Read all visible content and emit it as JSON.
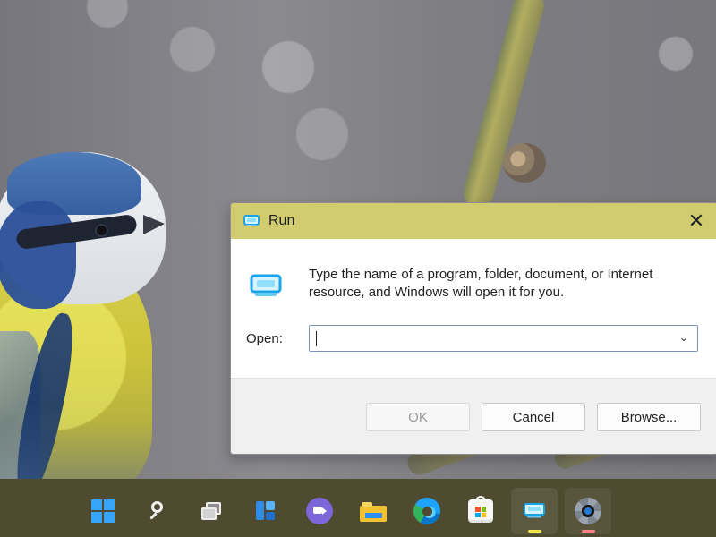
{
  "dialog": {
    "title": "Run",
    "description": "Type the name of a program, folder, document, or Internet resource, and Windows will open it for you.",
    "open_label": "Open:",
    "open_value": "",
    "dropdown_icon": "chevron-down-icon",
    "buttons": {
      "ok": "OK",
      "cancel": "Cancel",
      "browse": "Browse..."
    },
    "close_icon": "close-icon",
    "title_icon": "run-icon"
  },
  "taskbar": {
    "items": [
      {
        "name": "start",
        "icon": "windows-icon",
        "active": false
      },
      {
        "name": "search",
        "icon": "search-icon",
        "active": false
      },
      {
        "name": "task-view",
        "icon": "task-view-icon",
        "active": false
      },
      {
        "name": "widgets",
        "icon": "widgets-icon",
        "active": false
      },
      {
        "name": "chat",
        "icon": "chat-icon",
        "active": false
      },
      {
        "name": "file-explorer",
        "icon": "folder-icon",
        "active": false
      },
      {
        "name": "edge",
        "icon": "edge-icon",
        "active": false
      },
      {
        "name": "store",
        "icon": "store-icon",
        "active": false
      },
      {
        "name": "run",
        "icon": "run-icon",
        "active": true
      },
      {
        "name": "settings",
        "icon": "settings-icon",
        "active": false
      }
    ]
  },
  "colors": {
    "dialog_titlebar": "#d0cc6f",
    "taskbar": "#4f4b31",
    "run_indicator": "#f2e54a",
    "settings_indicator": "#ff7f86",
    "accent_blue": "#38a4f7"
  }
}
